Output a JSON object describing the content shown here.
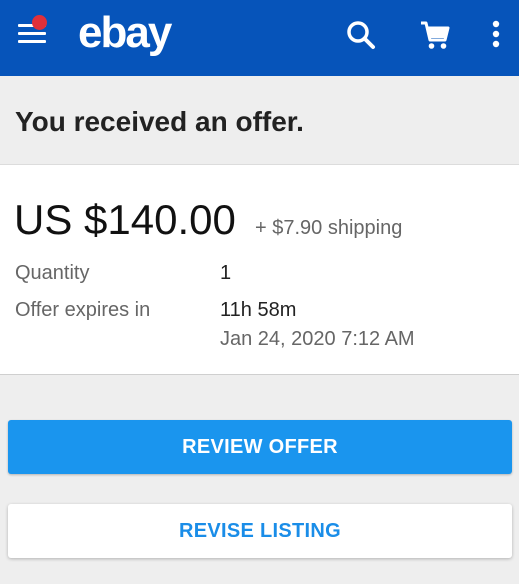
{
  "header": {
    "logo_text": "ebay",
    "menu_icon": "hamburger-menu-icon",
    "notification_badge_color": "#e0303a",
    "search_icon": "search-icon",
    "cart_icon": "cart-icon",
    "more_icon": "more-vertical-icon",
    "background_color": "#0654ba"
  },
  "page": {
    "title": "You received an offer."
  },
  "offer": {
    "price": "US $140.00",
    "shipping": "+ $7.90 shipping",
    "quantity_label": "Quantity",
    "quantity_value": "1",
    "expires_label": "Offer expires in",
    "expires_value": "11h 58m",
    "expires_datetime": "Jan 24, 2020 7:12 AM"
  },
  "actions": {
    "review_offer": "REVIEW OFFER",
    "revise_listing": "REVISE LISTING",
    "primary_color": "#1a95ee"
  }
}
